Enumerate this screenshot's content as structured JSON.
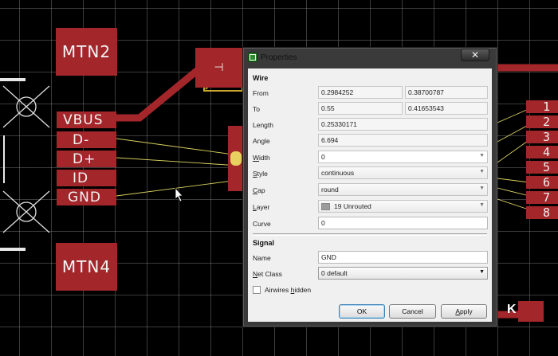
{
  "pcb": {
    "mount_pads": [
      "MTN2",
      "MTN4"
    ],
    "usb_pins": [
      "VBUS",
      "D-",
      "D+",
      "ID",
      "GND"
    ],
    "header_pins": [
      "1",
      "2",
      "3",
      "4",
      "5",
      "6",
      "7",
      "8"
    ],
    "colors": {
      "copper": "#a3262a",
      "silk": "#e8e8e8",
      "airwire": "#d8d060",
      "grid": "#828282",
      "outline": "#c8a832"
    }
  },
  "dialog": {
    "title": "Properties",
    "close_symbol": "✕",
    "wire_section": "Wire",
    "labels": {
      "from": "From",
      "to": "To",
      "length": "Length",
      "angle": "Angle",
      "width": "Width",
      "style": "Style",
      "cap": "Cap",
      "layer": "Layer",
      "curve": "Curve",
      "name": "Name",
      "net_class": "Net Class",
      "airwires_hidden": "Airwires hidden"
    },
    "values": {
      "from_x": "0.2984252",
      "from_y": "0.38700787",
      "to_x": "0.55",
      "to_y": "0.41653543",
      "length": "0.25330171",
      "angle": "6.694",
      "width": "0",
      "style": "continuous",
      "cap": "round",
      "layer": "19 Unrouted",
      "curve": "0",
      "name": "GND",
      "net_class": "0 default"
    },
    "signal_section": "Signal",
    "airwires_hidden_checked": false,
    "buttons": {
      "ok": "OK",
      "cancel": "Cancel",
      "apply": "Apply"
    }
  }
}
